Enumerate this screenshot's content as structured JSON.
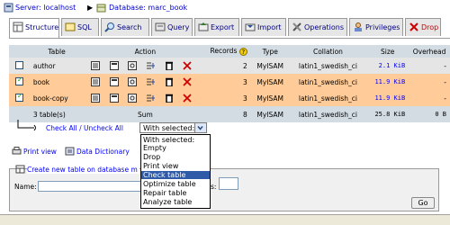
{
  "breadcrumb": {
    "server_label": "Server: localhost",
    "separator": "▶",
    "database_label": "Database: marc_book"
  },
  "tabs": [
    {
      "label": "Structure",
      "icon": "structure-icon",
      "active": true
    },
    {
      "label": "SQL",
      "icon": "sql-icon"
    },
    {
      "label": "Search",
      "icon": "search-icon"
    },
    {
      "label": "Query",
      "icon": "query-icon"
    },
    {
      "label": "Export",
      "icon": "export-icon"
    },
    {
      "label": "Import",
      "icon": "import-icon"
    },
    {
      "label": "Operations",
      "icon": "operations-icon"
    },
    {
      "label": "Privileges",
      "icon": "privileges-icon"
    },
    {
      "label": "Drop",
      "icon": "drop-icon",
      "color": "#cc0000"
    }
  ],
  "table": {
    "headers": {
      "table": "Table",
      "action": "Action",
      "records": "Records",
      "type": "Type",
      "collation": "Collation",
      "size": "Size",
      "overhead": "Overhead"
    },
    "rows": [
      {
        "checked": false,
        "name": "author",
        "records": "2",
        "type": "MyISAM",
        "collation": "latin1_swedish_ci",
        "size": "2.1 KiB",
        "overhead": "-",
        "highlight": false
      },
      {
        "checked": true,
        "name": "book",
        "records": "3",
        "type": "MyISAM",
        "collation": "latin1_swedish_ci",
        "size": "11.9 KiB",
        "overhead": "-",
        "highlight": true
      },
      {
        "checked": true,
        "name": "book-copy",
        "records": "3",
        "type": "MyISAM",
        "collation": "latin1_swedish_ci",
        "size": "11.9 KiB",
        "overhead": "-",
        "highlight": true
      }
    ],
    "summary": {
      "count": "3 table(s)",
      "label": "Sum",
      "records": "8",
      "type": "MyISAM",
      "collation": "latin1_swedish_ci",
      "size": "25.8 KiB",
      "overhead": "0 B"
    }
  },
  "bulk": {
    "check_all": "Check All / Uncheck All",
    "select_value": "With selected:",
    "options": [
      "With selected:",
      "Empty",
      "Drop",
      "Print view",
      "Check table",
      "Optimize table",
      "Repair table",
      "Analyze table"
    ],
    "highlighted_index": 4
  },
  "links": {
    "print_view": "Print view",
    "data_dictionary": "Data Dictionary"
  },
  "create_table": {
    "legend": "Create new table on database m",
    "name_label": "Name:",
    "fields_label": "s:",
    "go_label": "Go"
  },
  "colors": {
    "tab_link": "#00008b",
    "header_bg": "#d3dce3",
    "row_bg": "#e5e5e5",
    "selected_row_bg": "#ffcc99",
    "menu_highlight": "#2e5aa8"
  }
}
